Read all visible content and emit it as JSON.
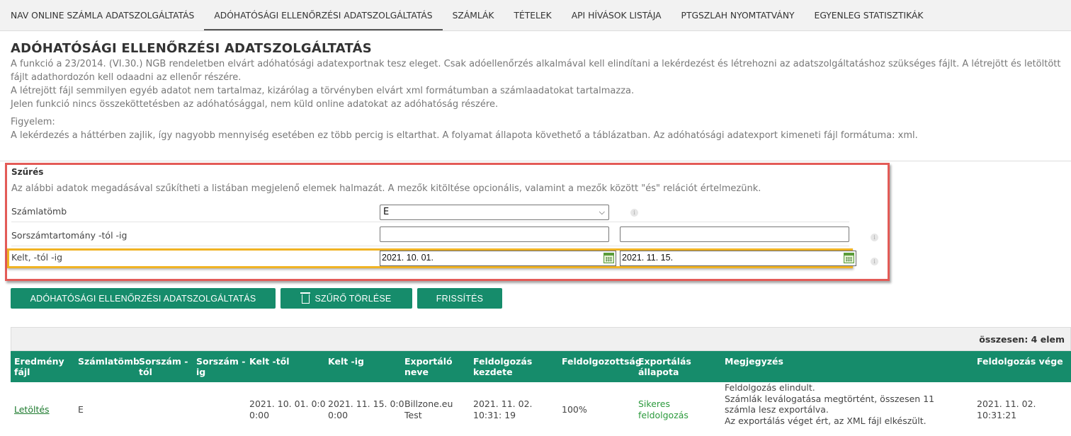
{
  "nav": {
    "items": [
      "NAV ONLINE SZÁMLA ADATSZOLGÁLTATÁS",
      "ADÓHATÓSÁGI ELLENŐRZÉSI ADATSZOLGÁLTATÁS",
      "SZÁMLÁK",
      "TÉTELEK",
      "API HÍVÁSOK LISTÁJA",
      "PTGSZLAH NYOMTATVÁNY",
      "EGYENLEG STATISZTIKÁK"
    ],
    "active_index": 1
  },
  "page": {
    "title": "ADÓHATÓSÁGI ELLENŐRZÉSI ADATSZOLGÁLTATÁS",
    "desc1": "A funkció a 23/2014. (VI.30.) NGB rendeletben elvárt adóhatósági adatexportnak tesz eleget. Csak adóellenőrzés alkalmával kell elindítani a lekérdezést és létrehozni az adatszolgáltatáshoz szükséges fájlt. A létrejött és letöltött fájlt adathordozón kell odaadni az ellenőr részére.",
    "desc2": "A létrejött fájl semmilyen egyéb adatot nem tartalmaz, kizárólag a törvényben elvárt xml formátumban a számlaadatokat tartalmazza.",
    "desc3": "Jelen funkció nincs összeköttetésben az adóhatósággal, nem küld online adatokat az adóhatóság részére.",
    "warn_title": "Figyelem:",
    "warn_text": "A lekérdezés a háttérben zajlik, így nagyobb mennyiség esetében ez több percig is eltarthat. A folyamat állapota követhető a táblázatban. Az adóhatósági adatexport kimeneti fájl formátuma: xml."
  },
  "filter": {
    "title": "Szűrés",
    "desc": "Az alábbi adatok megadásával szűkítheti a listában megjelenő elemek halmazát. A mezők kitöltése opcionális, valamint a mezők között \"és\" relációt értelmezünk.",
    "invoice_block_label": "Számlatömb",
    "invoice_block_value": "E",
    "serial_range_label": "Sorszámtartomány -tól -ig",
    "date_label": "Kelt, -tól -ig",
    "date_from": "2021. 10. 01.",
    "date_to": "2021. 11. 15."
  },
  "buttons": {
    "export": "ADÓHATÓSÁGI ELLENŐRZÉSI ADATSZOLGÁLTATÁS",
    "clear": "SZŰRŐ TÖRLÉSE",
    "refresh": "FRISSÍTÉS"
  },
  "table": {
    "total": "összesen: 4 elem",
    "headers": {
      "result_file": "Eredmény fájl",
      "invoice_block": "Számlatömb",
      "serial_from": "Sorszám - tól",
      "serial_to": "Sorszám - ig",
      "date_from": "Kelt -től",
      "date_to": "Kelt -ig",
      "exporter": "Exportáló neve",
      "proc_start": "Feldolgozás kezdete",
      "progress": "Feldolgozottság",
      "export_status": "Exportálás állapota",
      "note": "Megjegyzés",
      "proc_end": "Feldolgozás vége"
    },
    "row": {
      "result_file": "Letöltés",
      "invoice_block": "E",
      "date_from": "2021. 10. 01. 0:0 0:00",
      "date_to": "2021. 11. 15. 0:0 0:00",
      "exporter": "Billzone.eu Test",
      "proc_start": "2021. 11. 02. 10:31: 19",
      "progress": "100%",
      "export_status": "Sikeres feldolgozás",
      "note1": "Feldolgozás elindult.",
      "note2": "Számlák leválogatása megtörtént, összesen 11 számla lesz exportálva.",
      "note3": "Az exportálás véget ért, az XML fájl elkészült.",
      "proc_end": "2021. 11. 02. 10:31:21"
    }
  }
}
